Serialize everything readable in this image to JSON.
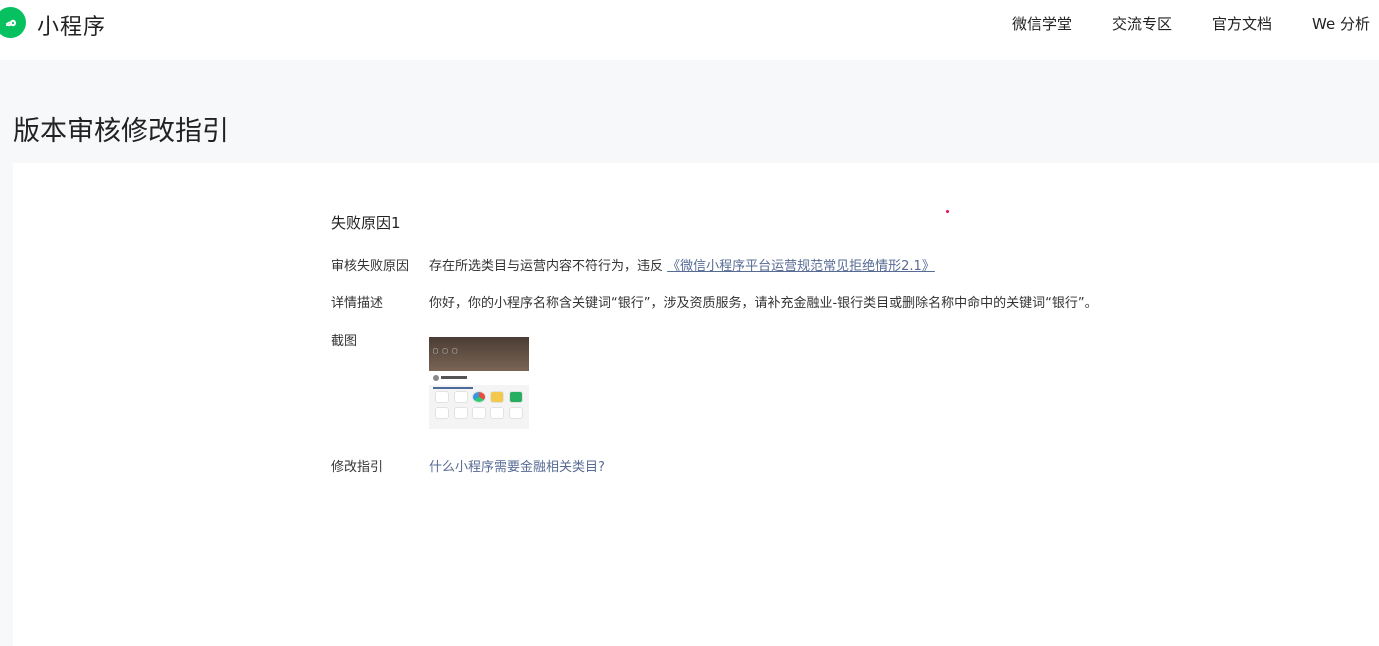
{
  "header": {
    "brand": "小程序",
    "nav": [
      "微信学堂",
      "交流专区",
      "官方文档",
      "We 分析"
    ]
  },
  "page_title": "版本审核修改指引",
  "failure": {
    "section_title": "失败原因1",
    "reason_label": "审核失败原因",
    "reason_text": "存在所选类目与运营内容不符行为，违反",
    "reason_link": "《微信小程序平台运营规范常见拒绝情形2.1》",
    "detail_label": "详情描述",
    "detail_text": "你好，你的小程序名称含关键词“银行”，涉及资质服务，请补充金融业-银行类目或删除名称中命中的关键词“银行”。",
    "screenshot_label": "截图",
    "guide_label": "修改指引",
    "guide_link": "什么小程序需要金融相关类目?"
  },
  "colors": {
    "accent": "#07c160",
    "link": "#576b95"
  }
}
